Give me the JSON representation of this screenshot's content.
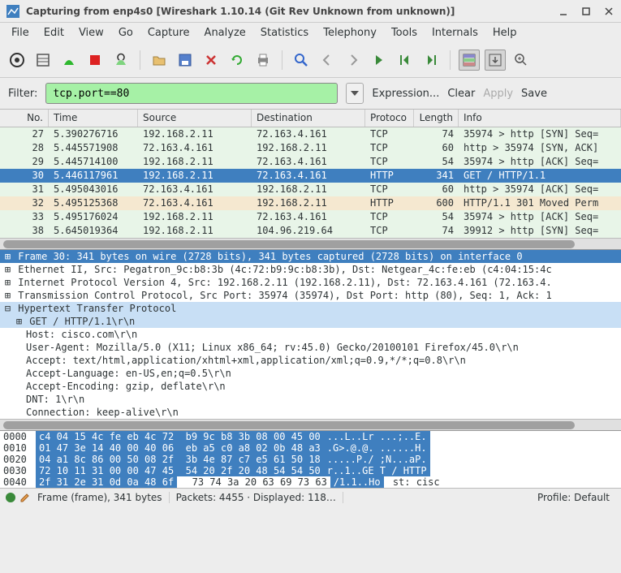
{
  "title": "Capturing from enp4s0    [Wireshark 1.10.14  (Git Rev Unknown from unknown)]",
  "menus": [
    "File",
    "Edit",
    "View",
    "Go",
    "Capture",
    "Analyze",
    "Statistics",
    "Telephony",
    "Tools",
    "Internals",
    "Help"
  ],
  "filter": {
    "label": "Filter:",
    "value": "tcp.port==80",
    "expression": "Expression...",
    "clear": "Clear",
    "apply": "Apply",
    "save": "Save"
  },
  "columns": {
    "no": "No.",
    "time": "Time",
    "source": "Source",
    "destination": "Destination",
    "protocol": "Protoco",
    "length": "Length",
    "info": "Info"
  },
  "packets": [
    {
      "no": "27",
      "time": "5.390276716",
      "src": "192.168.2.11",
      "dst": "72.163.4.161",
      "proto": "TCP",
      "len": "74",
      "info": "35974 > http [SYN] Seq=",
      "cls": "green"
    },
    {
      "no": "28",
      "time": "5.445571908",
      "src": "72.163.4.161",
      "dst": "192.168.2.11",
      "proto": "TCP",
      "len": "60",
      "info": "http > 35974 [SYN, ACK]",
      "cls": "green"
    },
    {
      "no": "29",
      "time": "5.445714100",
      "src": "192.168.2.11",
      "dst": "72.163.4.161",
      "proto": "TCP",
      "len": "54",
      "info": "35974 > http [ACK] Seq=",
      "cls": "green"
    },
    {
      "no": "30",
      "time": "5.446117961",
      "src": "192.168.2.11",
      "dst": "72.163.4.161",
      "proto": "HTTP",
      "len": "341",
      "info": "GET / HTTP/1.1",
      "cls": "selected"
    },
    {
      "no": "31",
      "time": "5.495043016",
      "src": "72.163.4.161",
      "dst": "192.168.2.11",
      "proto": "TCP",
      "len": "60",
      "info": "http > 35974 [ACK] Seq=",
      "cls": "green"
    },
    {
      "no": "32",
      "time": "5.495125368",
      "src": "72.163.4.161",
      "dst": "192.168.2.11",
      "proto": "HTTP",
      "len": "600",
      "info": "HTTP/1.1 301 Moved Perm",
      "cls": "orange"
    },
    {
      "no": "33",
      "time": "5.495176024",
      "src": "192.168.2.11",
      "dst": "72.163.4.161",
      "proto": "TCP",
      "len": "54",
      "info": "35974 > http [ACK] Seq=",
      "cls": "green"
    },
    {
      "no": "38",
      "time": "5.645019364",
      "src": "192.168.2.11",
      "dst": "104.96.219.64",
      "proto": "TCP",
      "len": "74",
      "info": "39912 > http [SYN] Seq=",
      "cls": "green"
    }
  ],
  "details": {
    "frame": "Frame 30: 341 bytes on wire (2728 bits), 341 bytes captured (2728 bits) on interface 0",
    "eth": "Ethernet II, Src: Pegatron_9c:b8:3b (4c:72:b9:9c:b8:3b), Dst: Netgear_4c:fe:eb (c4:04:15:4c",
    "ip": "Internet Protocol Version 4, Src: 192.168.2.11 (192.168.2.11), Dst: 72.163.4.161 (72.163.4.",
    "tcp": "Transmission Control Protocol, Src Port: 35974 (35974), Dst Port: http (80), Seq: 1, Ack: 1",
    "http": "Hypertext Transfer Protocol",
    "get": "GET / HTTP/1.1\\r\\n",
    "host": "Host: cisco.com\\r\\n",
    "ua": "User-Agent: Mozilla/5.0 (X11; Linux x86_64; rv:45.0) Gecko/20100101 Firefox/45.0\\r\\n",
    "accept": "Accept: text/html,application/xhtml+xml,application/xml;q=0.9,*/*;q=0.8\\r\\n",
    "lang": "Accept-Language: en-US,en;q=0.5\\r\\n",
    "enc": "Accept-Encoding: gzip, deflate\\r\\n",
    "dnt": "DNT: 1\\r\\n",
    "conn": "Connection: keep-alive\\r\\n"
  },
  "hex": [
    {
      "off": "0000",
      "b": "c4 04 15 4c fe eb 4c 72  b9 9c b8 3b 08 00 45 00",
      "a": "...L..Lr ...;..E."
    },
    {
      "off": "0010",
      "b": "01 47 3e 14 40 00 40 06  eb a5 c0 a8 02 0b 48 a3",
      "a": ".G>.@.@. ......H."
    },
    {
      "off": "0020",
      "b": "04 a1 8c 86 00 50 08 2f  3b 4e 87 c7 e5 61 50 18",
      "a": ".....P./ ;N...aP."
    },
    {
      "off": "0030",
      "b": "72 10 11 31 00 00 47 45  54 20 2f 20 48 54 54 50",
      "a": "r..1..GE T / HTTP"
    },
    {
      "off": "0040",
      "b": "2f 31 2e 31 0d 0a 48 6f  73 74 3a 20 63 69 73 63",
      "a": "/1.1..Ho st: cisc"
    }
  ],
  "status": {
    "frame": "Frame (frame), 341 bytes",
    "packets": "Packets: 4455 · Displayed: 118…",
    "profile": "Profile: Default"
  }
}
